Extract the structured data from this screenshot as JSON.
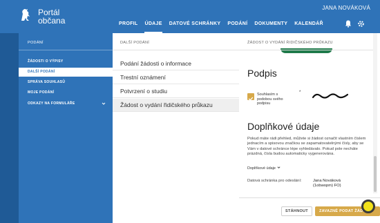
{
  "app": {
    "logo_line1": "Portál",
    "logo_line2": "občana",
    "user_name": "JANA NOVÁKOVÁ"
  },
  "nav": {
    "items": [
      "PROFIL",
      "ÚDAJE",
      "DATOVÉ SCHRÁNKY",
      "PODÁNÍ",
      "DOKUMENTY",
      "KALENDÁŘ"
    ],
    "active": "ÚDAJE"
  },
  "sidebar": {
    "title": "PODÁNÍ",
    "items": [
      {
        "label": "ŽÁDOSTI O VÝPISY"
      },
      {
        "label": "DALŠÍ PODÁNÍ",
        "active": true
      },
      {
        "label": "SPRÁVA SOUHLASŮ"
      },
      {
        "label": "MOJE PODÁNÍ"
      },
      {
        "label": "ODKAZY NA FORMULÁŘE",
        "expandable": true
      }
    ]
  },
  "middle": {
    "title": "DALŠÍ PODÁNÍ",
    "forms": [
      {
        "label": "Podání žádosti o informace"
      },
      {
        "label": "Trestní oznámení"
      },
      {
        "label": "Potvrzení o studiu"
      },
      {
        "label": "Žádost o vydání řidičského průkazu",
        "selected": true
      }
    ]
  },
  "detail": {
    "title": "ŽÁDOST O VYDÁNÍ ŘIDIČSKÉHO PRŮKAZU",
    "signature_heading": "Podpis",
    "consent_label": "Souhlasím s podobou svého podpisu",
    "consent_checked": true,
    "required_mark": "*",
    "additional_heading": "Doplňkové údaje",
    "additional_text": "Pokud máte rádi přehled, můžete si žádost označit vlastním číslem jednacím a spisovou značkou se zapamatovatelnými čísly, aby se Vám v datové schránce lépe vyhledávalo. Pokud pole necháte prázdná, čísla budou automaticky vygenerována.",
    "additional_link": "Doplňkové údaje",
    "ds_label": "Datová schránka pro odeslání:",
    "ds_value_line1": "Jana Nováková",
    "ds_value_line2": "(1obwopm) FO)"
  },
  "buttons": {
    "download": "STÁHNOUT",
    "submit": "ZAVAZNĚ PODAT ŽÁDOST"
  },
  "icons": {
    "bell": "bell-icon",
    "gear": "gear-icon",
    "chevron": "chevron-down-icon",
    "logo": "lion-emblem-icon"
  },
  "colors": {
    "header": "#2f73b8",
    "sidebar": "#2f73b8",
    "accent": "#d7a94a"
  }
}
